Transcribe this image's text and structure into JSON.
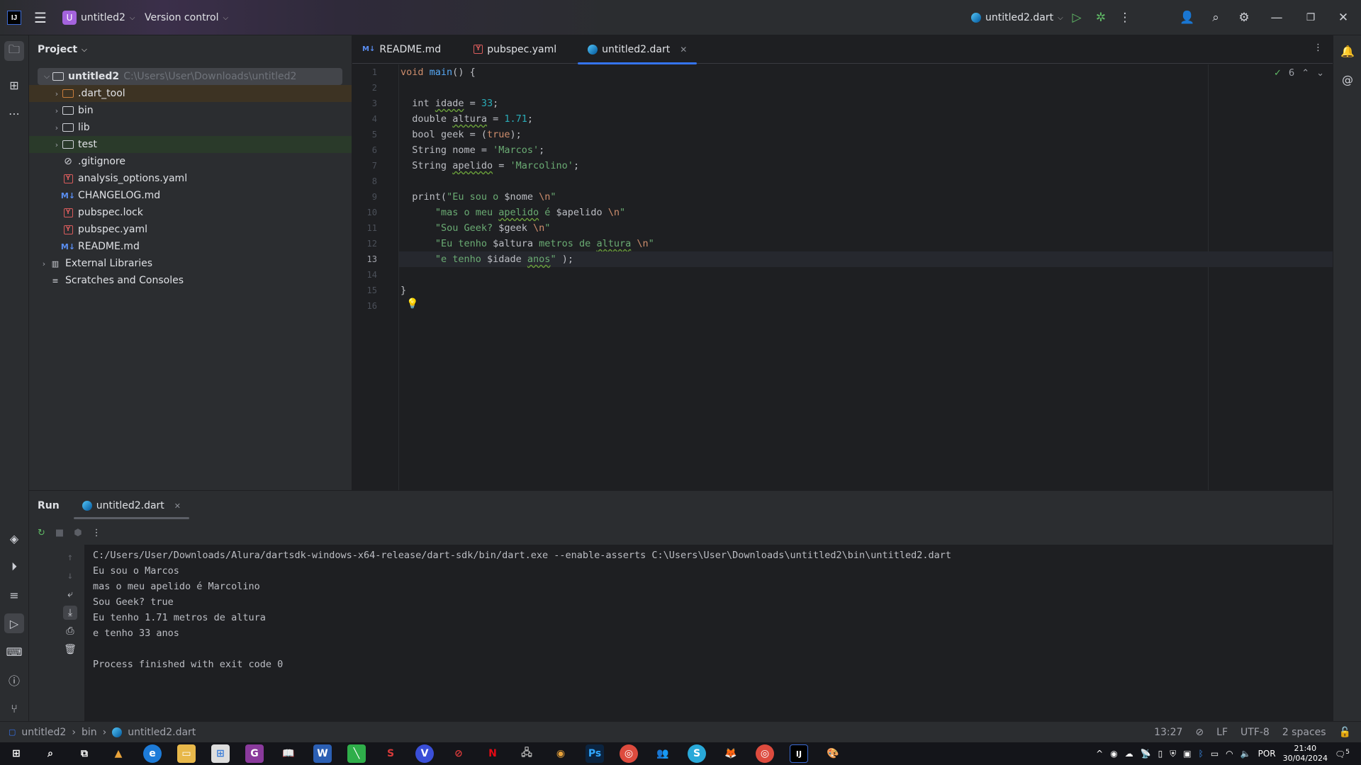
{
  "titlebar": {
    "logo": "IJ",
    "project_badge": "U",
    "project_name": "untitled2",
    "version_control": "Version control",
    "run_config": "untitled2.dart",
    "icons": [
      "hamburger-menu-icon",
      "run-icon",
      "debug-icon",
      "more-icon",
      "add-user-icon",
      "search-icon",
      "settings-icon",
      "minimize-icon",
      "restore-icon",
      "close-icon"
    ]
  },
  "project_panel": {
    "title": "Project",
    "root": {
      "name": "untitled2",
      "path": "C:\\Users\\User\\Downloads\\untitled2"
    },
    "items": [
      {
        "name": ".dart_tool",
        "type": "folder"
      },
      {
        "name": "bin",
        "type": "folder"
      },
      {
        "name": "lib",
        "type": "folder"
      },
      {
        "name": "test",
        "type": "folder"
      },
      {
        "name": ".gitignore",
        "type": "ignore"
      },
      {
        "name": "analysis_options.yaml",
        "type": "yaml"
      },
      {
        "name": "CHANGELOG.md",
        "type": "md"
      },
      {
        "name": "pubspec.lock",
        "type": "yaml"
      },
      {
        "name": "pubspec.yaml",
        "type": "yaml"
      },
      {
        "name": "README.md",
        "type": "md"
      }
    ],
    "external_libraries": "External Libraries",
    "scratches": "Scratches and Consoles"
  },
  "editor": {
    "tabs": [
      {
        "label": "README.md",
        "icon": "M↓"
      },
      {
        "label": "pubspec.yaml",
        "icon": "Y"
      },
      {
        "label": "untitled2.dart",
        "active": true
      }
    ],
    "inspection_count": "6",
    "current_line": 13,
    "line_numbers": [
      "1",
      "2",
      "3",
      "4",
      "5",
      "6",
      "7",
      "8",
      "9",
      "10",
      "11",
      "12",
      "13",
      "14",
      "15",
      "16"
    ],
    "code": [
      "void main() {",
      "",
      "  int idade = 33;",
      "  double altura = 1.71;",
      "  bool geek = (true);",
      "  String nome = 'Marcos';",
      "  String apelido = 'Marcolino';",
      "",
      "  print(\"Eu sou o $nome \\n\"",
      "      \"mas o meu apelido é $apelido \\n\"",
      "      \"Sou Geek? $geek \\n\"",
      "      \"Eu tenho $altura metros de altura \\n\"",
      "      \"e tenho $idade anos\" );",
      "",
      "}",
      ""
    ]
  },
  "run_panel": {
    "title": "Run",
    "tab": "untitled2.dart",
    "output": [
      "C:/Users/User/Downloads/Alura/dartsdk-windows-x64-release/dart-sdk/bin/dart.exe --enable-asserts C:\\Users\\User\\Downloads\\untitled2\\bin\\untitled2.dart",
      "Eu sou o Marcos",
      "mas o meu apelido é Marcolino",
      "Sou Geek? true",
      "Eu tenho 1.71 metros de altura",
      "e tenho 33 anos",
      "",
      "Process finished with exit code 0"
    ]
  },
  "statusbar": {
    "breadcrumb": [
      "untitled2",
      "bin",
      "untitled2.dart"
    ],
    "position": "13:27",
    "line_ending": "LF",
    "encoding": "UTF-8",
    "indent": "2 spaces"
  },
  "taskbar": {
    "language": "POR",
    "time": "21:40",
    "date": "30/04/2024",
    "notifications": "5"
  }
}
